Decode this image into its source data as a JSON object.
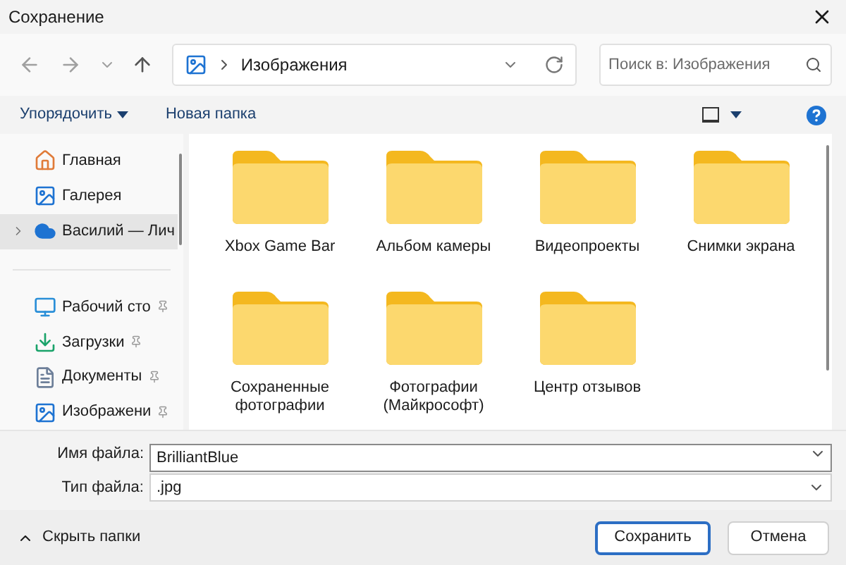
{
  "window": {
    "title": "Сохранение"
  },
  "address_bar": {
    "path": "Изображения"
  },
  "search": {
    "placeholder": "Поиск в: Изображения"
  },
  "toolbar": {
    "organize": "Упорядочить",
    "new_folder": "Новая папка"
  },
  "sidebar": {
    "items": [
      {
        "kind": "nav",
        "label": "Главная",
        "selected": false,
        "expandable": false
      },
      {
        "kind": "nav",
        "label": "Галерея",
        "selected": false,
        "expandable": false
      },
      {
        "kind": "nav",
        "label": "Василий — Лич",
        "selected": true,
        "expandable": true
      },
      {
        "kind": "divider"
      },
      {
        "kind": "pinned",
        "label": "Рабочий сто",
        "selected": false
      },
      {
        "kind": "pinned",
        "label": "Загрузки",
        "selected": false
      },
      {
        "kind": "pinned",
        "label": "Документы",
        "selected": false
      },
      {
        "kind": "pinned",
        "label": "Изображени",
        "selected": false
      }
    ]
  },
  "folders": [
    {
      "name": "Xbox Game Bar"
    },
    {
      "name": "Альбом камеры"
    },
    {
      "name": "Видеопроекты"
    },
    {
      "name": "Снимки экрана"
    },
    {
      "name": "Сохраненные фотографии"
    },
    {
      "name": "Фотографии (Майкрософт)"
    },
    {
      "name": "Центр отзывов"
    }
  ],
  "file_name": {
    "label": "Имя файла:",
    "value": "BrilliantBlue"
  },
  "file_type": {
    "label": "Тип файла:",
    "value": ".jpg"
  },
  "hide_folders": "Скрыть папки",
  "buttons": [
    {
      "kind": "primary",
      "label": "Сохранить"
    },
    {
      "kind": "secondary",
      "label": "Отмена"
    }
  ]
}
